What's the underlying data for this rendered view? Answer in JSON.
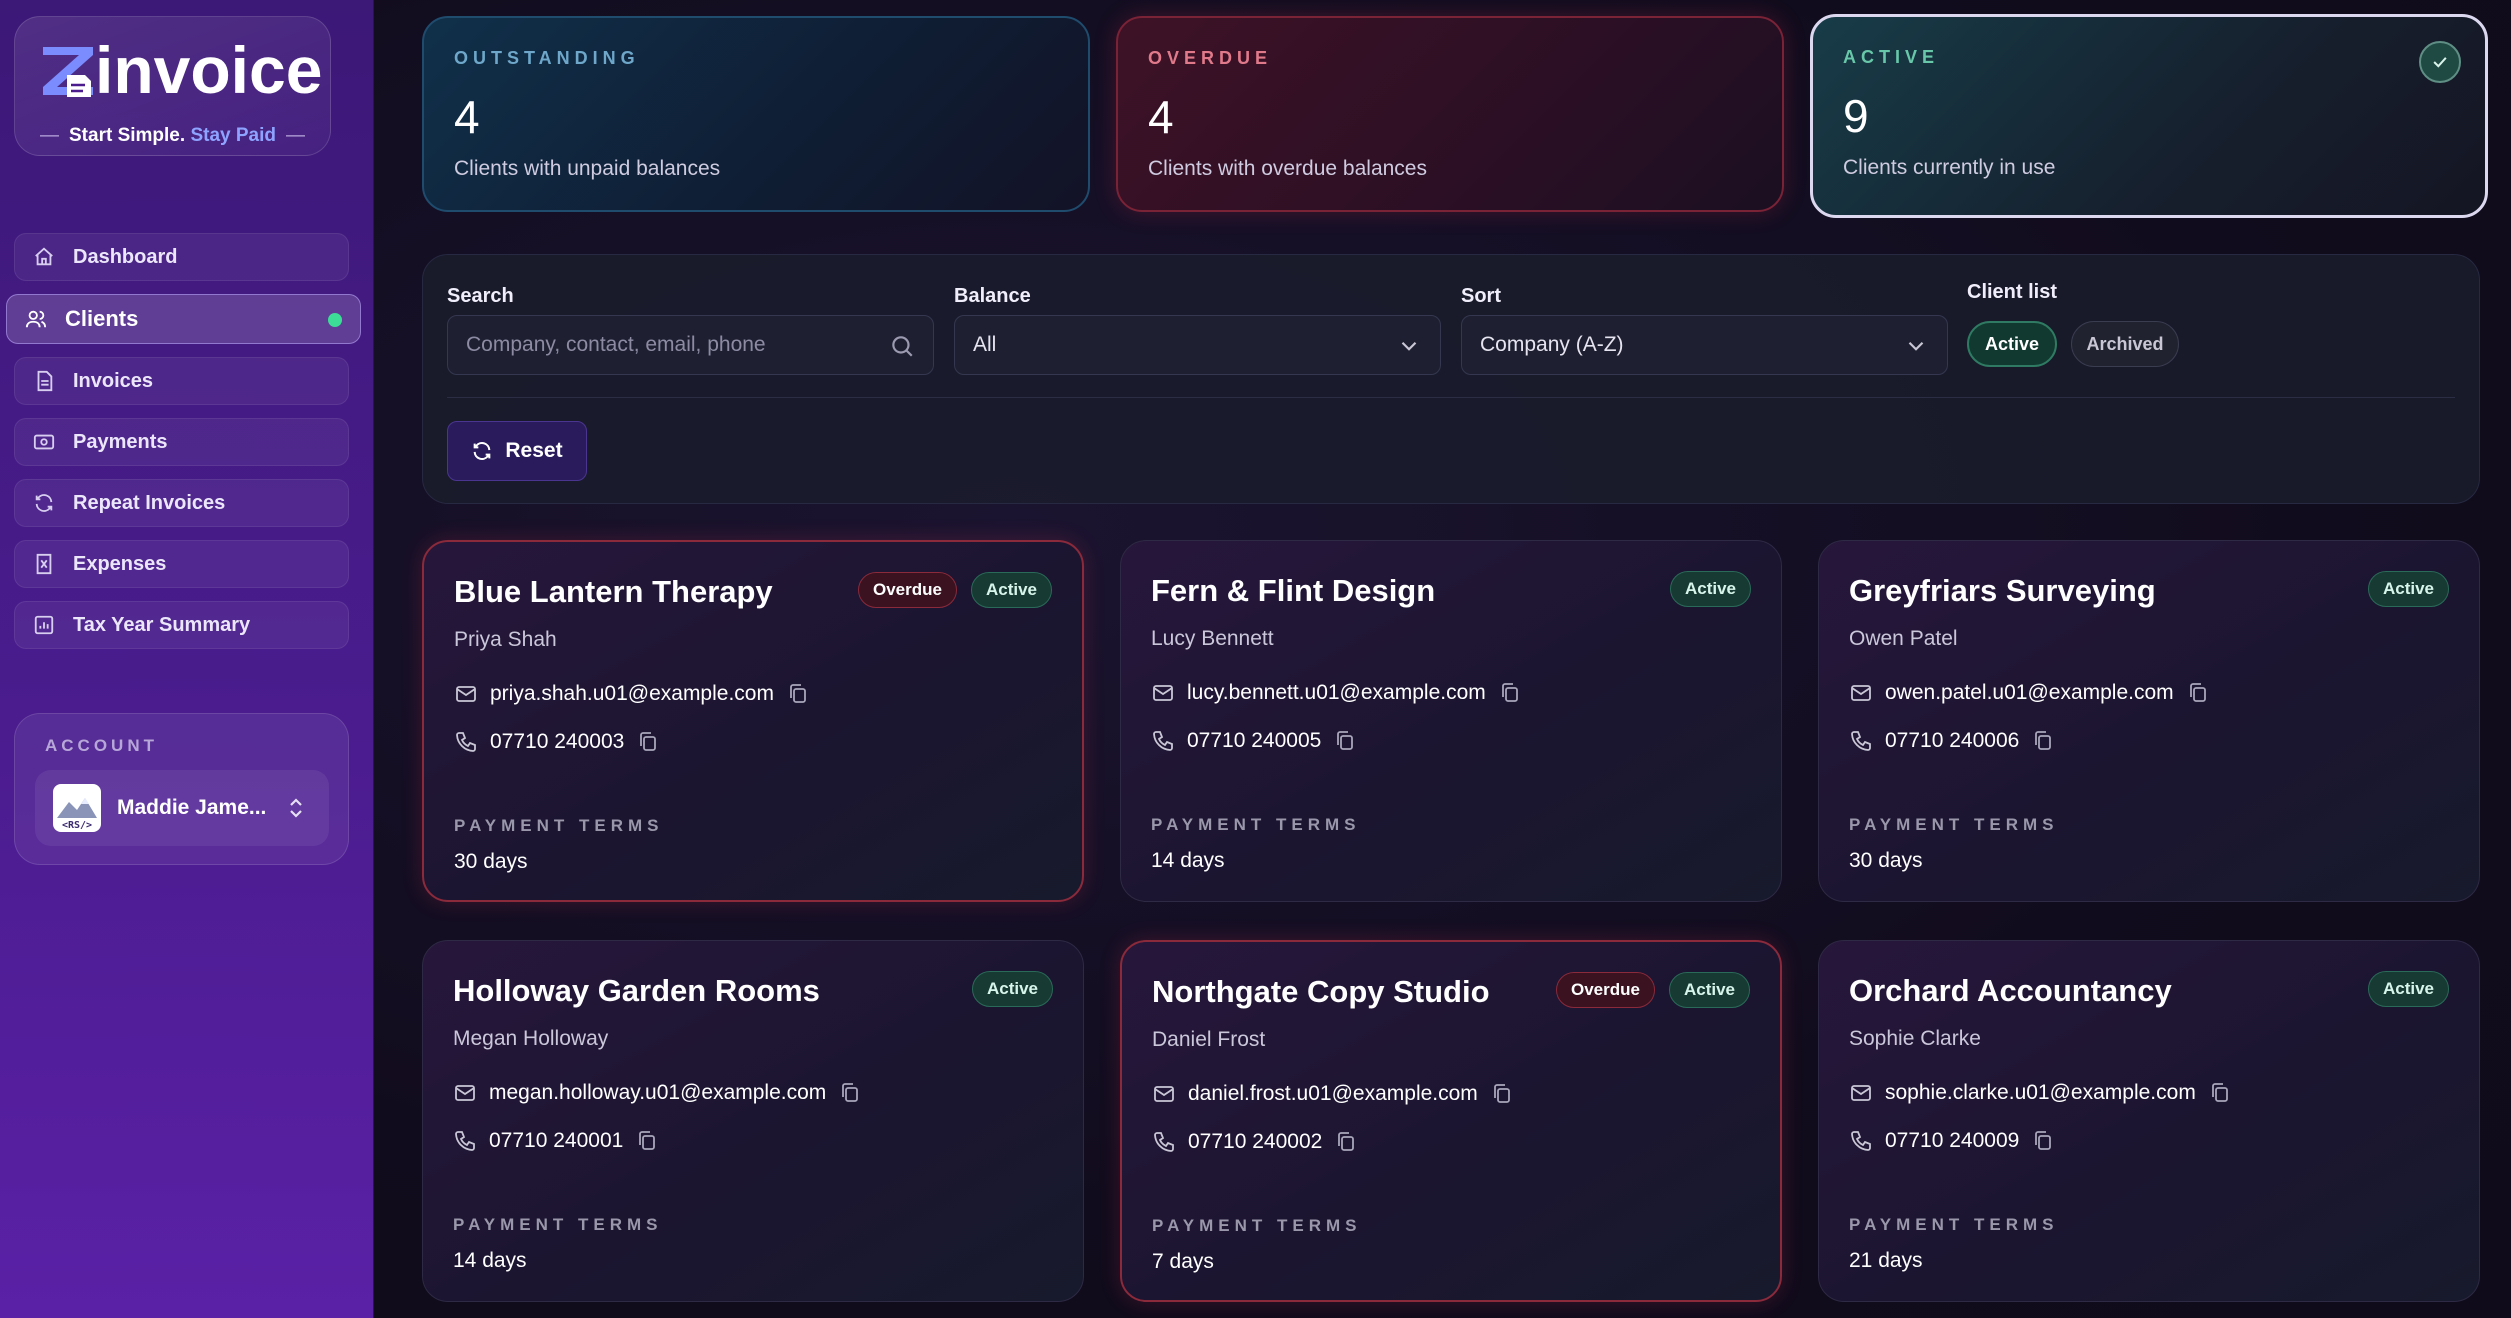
{
  "brand": {
    "name": "invoice",
    "tagline_start": "Start Simple.",
    "tagline_accent": "Stay Paid"
  },
  "nav": {
    "items": [
      {
        "label": "Dashboard",
        "icon": "home-icon"
      },
      {
        "label": "Clients",
        "icon": "users-icon",
        "active": true
      },
      {
        "label": "Invoices",
        "icon": "file-icon"
      },
      {
        "label": "Payments",
        "icon": "cash-icon"
      },
      {
        "label": "Repeat Invoices",
        "icon": "repeat-icon"
      },
      {
        "label": "Expenses",
        "icon": "receipt-icon"
      },
      {
        "label": "Tax Year Summary",
        "icon": "chart-icon"
      }
    ]
  },
  "account": {
    "label": "ACCOUNT",
    "name": "Maddie Jame...",
    "avatar_text": "<RS/>"
  },
  "stats": {
    "outstanding": {
      "label": "OUTSTANDING",
      "value": "4",
      "sub": "Clients with unpaid balances"
    },
    "overdue": {
      "label": "OVERDUE",
      "value": "4",
      "sub": "Clients with overdue balances"
    },
    "active": {
      "label": "ACTIVE",
      "value": "9",
      "sub": "Clients currently in use"
    }
  },
  "filters": {
    "search_label": "Search",
    "search_placeholder": "Company, contact, email, phone",
    "balance_label": "Balance",
    "balance_value": "All",
    "sort_label": "Sort",
    "sort_value": "Company (A-Z)",
    "client_list_label": "Client list",
    "client_list_active": "Active",
    "client_list_archived": "Archived",
    "reset_label": "Reset"
  },
  "cards": {
    "terms_label": "PAYMENT TERMS",
    "badge_overdue": "Overdue",
    "badge_active": "Active",
    "items": [
      {
        "company": "Blue Lantern Therapy",
        "contact": "Priya Shah",
        "email": "priya.shah.u01@example.com",
        "phone": "07710 240003",
        "terms": "30 days",
        "overdue": true
      },
      {
        "company": "Fern & Flint Design",
        "contact": "Lucy Bennett",
        "email": "lucy.bennett.u01@example.com",
        "phone": "07710 240005",
        "terms": "14 days",
        "overdue": false
      },
      {
        "company": "Greyfriars Surveying",
        "contact": "Owen Patel",
        "email": "owen.patel.u01@example.com",
        "phone": "07710 240006",
        "terms": "30 days",
        "overdue": false
      },
      {
        "company": "Holloway Garden Rooms",
        "contact": "Megan Holloway",
        "email": "megan.holloway.u01@example.com",
        "phone": "07710 240001",
        "terms": "14 days",
        "overdue": false
      },
      {
        "company": "Northgate Copy Studio",
        "contact": "Daniel Frost",
        "email": "daniel.frost.u01@example.com",
        "phone": "07710 240002",
        "terms": "7 days",
        "overdue": true
      },
      {
        "company": "Orchard Accountancy",
        "contact": "Sophie Clarke",
        "email": "sophie.clarke.u01@example.com",
        "phone": "07710 240009",
        "terms": "21 days",
        "overdue": false
      }
    ]
  },
  "colors": {
    "sidebar": "#4a1c8e",
    "accent_green": "#3ddc97",
    "overdue_red": "#8a2a3b",
    "tagline_accent": "#8ea3ff"
  }
}
